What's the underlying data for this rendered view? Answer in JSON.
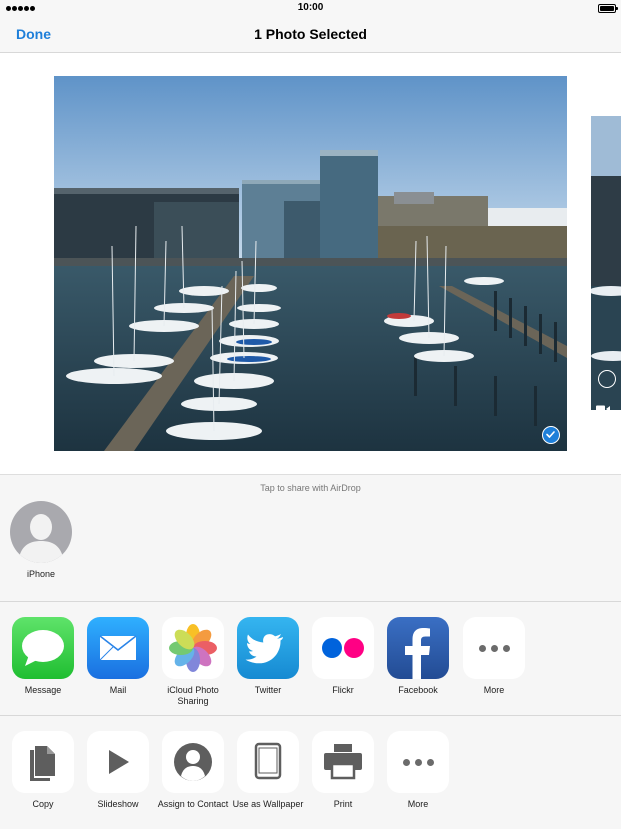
{
  "status_bar": {
    "time": "10:00"
  },
  "nav": {
    "done_label": "Done",
    "title": "1 Photo Selected"
  },
  "airdrop": {
    "hint": "Tap to share with AirDrop",
    "contacts": [
      {
        "name": "iPhone",
        "icon": "person-silhouette-icon"
      }
    ]
  },
  "share_apps": [
    {
      "label": "Message",
      "icon": "message-icon",
      "color": "#3fd24a"
    },
    {
      "label": "Mail",
      "icon": "mail-icon",
      "color": "#1a8ff0"
    },
    {
      "label": "iCloud Photo Sharing",
      "icon": "photos-icon",
      "color": "#ffffff"
    },
    {
      "label": "Twitter",
      "icon": "twitter-icon",
      "color": "#1f9fdf"
    },
    {
      "label": "Flickr",
      "icon": "flickr-icon",
      "color": "#ffffff"
    },
    {
      "label": "Facebook",
      "icon": "facebook-icon",
      "color": "#2d5ea8"
    },
    {
      "label": "More",
      "icon": "more-icon",
      "color": "#ffffff"
    }
  ],
  "actions": [
    {
      "label": "Copy",
      "icon": "copy-icon"
    },
    {
      "label": "Slideshow",
      "icon": "play-icon"
    },
    {
      "label": "Assign to Contact",
      "icon": "contact-icon"
    },
    {
      "label": "Use as Wallpaper",
      "icon": "ipad-icon"
    },
    {
      "label": "Print",
      "icon": "printer-icon"
    },
    {
      "label": "More",
      "icon": "more-icon"
    }
  ],
  "colors": {
    "accent": "#1e7fd9",
    "sheet_background": "#f6f6f6"
  }
}
